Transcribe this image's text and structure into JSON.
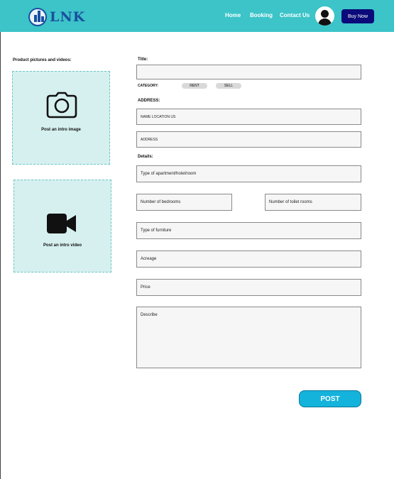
{
  "header": {
    "logo_text": "LNK",
    "nav": [
      "Home",
      "Booking",
      "Contact Us"
    ],
    "buy_label": "Buy Now",
    "accent": "#3cc4c8",
    "buy_color": "#0a0a7a"
  },
  "media": {
    "title": "Product pictures and videos:",
    "image_label": "Post an intro image",
    "video_label": "Post an intro video",
    "image_icon": "camera-icon",
    "video_icon": "video-camera-icon"
  },
  "form": {
    "title_label": "Title:",
    "category_label": "CATEGORY:",
    "categories": [
      "RENT",
      "SELL"
    ],
    "address_label": "ADDRESS:",
    "name_location": "NAME LOCATION US",
    "address": "ADDRESS",
    "details_label": "Details:",
    "type": "Type of apartment/hotel/room",
    "bedrooms": "Number of bedrooms",
    "toilets": "Number of toilet rooms",
    "furniture": "Type of furniture",
    "acreage": "Acreage",
    "price": "Price",
    "describe": "Describe",
    "post_label": "POST"
  }
}
